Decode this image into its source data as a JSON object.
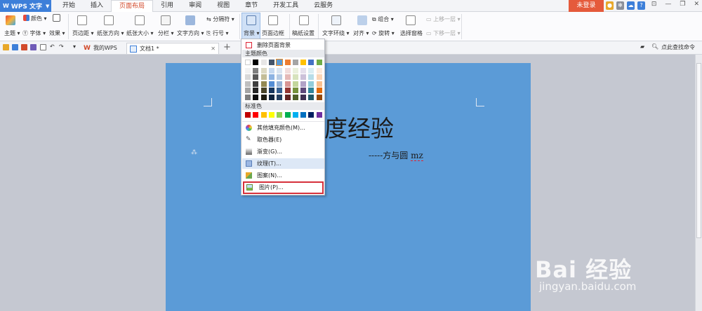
{
  "app": {
    "name": "WPS 文字",
    "logo": "W"
  },
  "menu_tabs": [
    "开始",
    "插入",
    "页面布局",
    "引用",
    "审阅",
    "视图",
    "章节",
    "开发工具",
    "云服务"
  ],
  "login_label": "未登录",
  "ribbon": {
    "theme": "主题",
    "color": "颜色",
    "font": "字体",
    "effect": "效果",
    "margins": "页边距",
    "orientation": "纸张方向",
    "size": "纸张大小",
    "columns": "分栏",
    "text_dir": "文字方向",
    "separator": "分隔符",
    "line_no": "行号",
    "background": "背景",
    "border": "页面边框",
    "paper_setup": "稿纸设置",
    "wrap": "文字环绕",
    "align": "对齐",
    "group": "组合",
    "rotate": "旋转",
    "select_pane": "选择窗格",
    "bring_fwd": "上移一层",
    "send_back": "下移一层"
  },
  "doc_tabs": [
    "我的WPS",
    "文档1 *"
  ],
  "add_tab": "+",
  "find_placeholder": "点此查找命令",
  "document": {
    "title": "度经验",
    "author_prefix": "-----方与圆 ",
    "author_suffix": "mz"
  },
  "dropdown": {
    "remove_bg": "删除页面背景",
    "theme_colors_header": "主题颜色",
    "standard_colors_header": "标准色",
    "more_colors": "其他填充颜色(M)...",
    "eyedropper": "取色器(E)",
    "gradient": "渐变(G)...",
    "texture": "纹理(T)...",
    "pattern": "图案(N)...",
    "picture": "图片(P)..."
  },
  "theme_colors": [
    [
      "#ffffff",
      "#000000",
      "#eeece1",
      "#1f497d",
      "#4f81bd",
      "#c0504d",
      "#9bbb59",
      "#8064a2",
      "#4bacc6",
      "#f79646"
    ],
    [
      "#f2f2f2",
      "#7f7f7f",
      "#ddd9c3",
      "#c6d9f0",
      "#dbe5f1",
      "#f2dcdb",
      "#ebf1dd",
      "#e5e0ec",
      "#dbeef3",
      "#fdeada"
    ],
    [
      "#d8d8d8",
      "#595959",
      "#c4bd97",
      "#8db3e2",
      "#b8cce4",
      "#e5b9b7",
      "#d7e3bc",
      "#ccc1d9",
      "#b7dde8",
      "#fbd5b5"
    ],
    [
      "#bfbfbf",
      "#3f3f3f",
      "#938953",
      "#548dd4",
      "#95b3d7",
      "#d99694",
      "#c3d69b",
      "#b2a2c7",
      "#92cddc",
      "#fac08f"
    ],
    [
      "#a5a5a5",
      "#262626",
      "#494429",
      "#17365d",
      "#366092",
      "#953734",
      "#76923c",
      "#5f497a",
      "#31859b",
      "#e36c09"
    ],
    [
      "#7f7f7f",
      "#0c0c0c",
      "#1d1b10",
      "#0f243e",
      "#244061",
      "#632423",
      "#4f6128",
      "#3f3151",
      "#205867",
      "#974806"
    ]
  ],
  "theme_top_row": [
    "#ffffff",
    "#000000",
    "#e7e6e6",
    "#44546a",
    "#5b9bd5",
    "#ed7d31",
    "#a5a5a5",
    "#ffc000",
    "#4472c4",
    "#70ad47"
  ],
  "standard_colors": [
    "#c00000",
    "#ff0000",
    "#ffc000",
    "#ffff00",
    "#92d050",
    "#00b050",
    "#00b0f0",
    "#0070c0",
    "#002060",
    "#7030a0"
  ],
  "watermark": {
    "brand": "Bai 经验",
    "url": "jingyan.baidu.com"
  }
}
